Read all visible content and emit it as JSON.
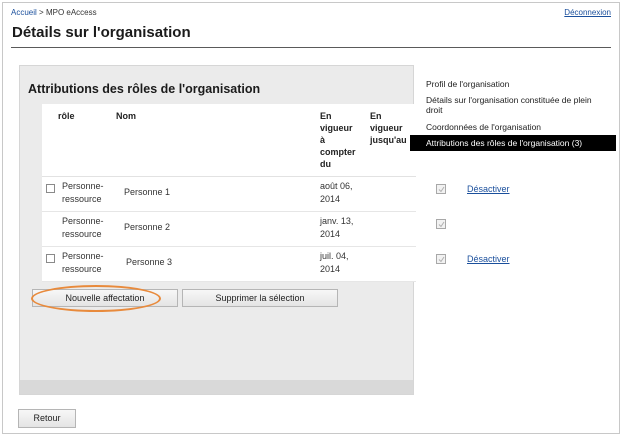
{
  "breadcrumb": {
    "home": "Accueil",
    "separator": ">",
    "current": "MPO eAccess"
  },
  "header": {
    "logout": "Déconnexion",
    "title": "Détails sur l'organisation"
  },
  "panel": {
    "title": "Attributions des rôles de l'organisation",
    "columns": {
      "role": "rôle",
      "name": "Nom",
      "from": [
        "En",
        "vigueur",
        "à",
        "compter",
        "du"
      ],
      "until": [
        "En",
        "vigueur",
        "jusqu'au"
      ]
    },
    "rows": [
      {
        "role": [
          "Personne-",
          "ressource"
        ],
        "name": "Personne 1",
        "date": [
          "août 06,",
          "2014"
        ],
        "has_checkbox": true,
        "action": "Désactiver"
      },
      {
        "role": [
          "Personne-",
          "ressource"
        ],
        "name": "Personne 2",
        "date": [
          "janv. 13,",
          "2014"
        ],
        "has_checkbox": false,
        "action": ""
      },
      {
        "role": [
          "Personne-",
          "ressource"
        ],
        "name": "Personne 3",
        "date": [
          "juil. 04,",
          "2014"
        ],
        "has_checkbox": true,
        "action": "Désactiver"
      }
    ],
    "buttons": {
      "new": "Nouvelle affectation",
      "delete": "Supprimer la sélection"
    }
  },
  "sidenav": {
    "items": [
      {
        "label": "Profil de l'organisation"
      },
      {
        "label": "Détails sur l'organisation constituée de plein droit"
      },
      {
        "label": "Coordonnées de l'organisation"
      },
      {
        "label": "Attributions des rôles de l'organisation (3)"
      }
    ]
  },
  "footer": {
    "back": "Retour"
  },
  "colors": {
    "link": "#1a4f9c",
    "highlight": "#e88a3c",
    "active_nav_bg": "#000000"
  },
  "icons": {
    "disabled_checkbox": "disabled-checkbox-icon"
  }
}
